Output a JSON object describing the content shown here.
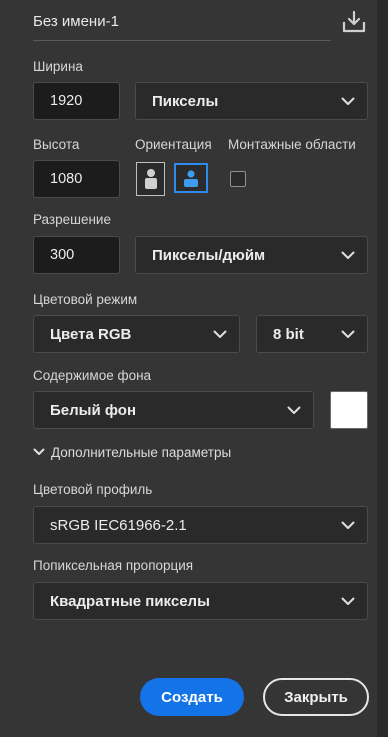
{
  "document_name": "Без имени-1",
  "width": {
    "label": "Ширина",
    "value": "1920",
    "unit": "Пикселы"
  },
  "height": {
    "label": "Высота",
    "value": "1080"
  },
  "orientation": {
    "label": "Ориентация",
    "selected": "landscape"
  },
  "artboards": {
    "label": "Монтажные области",
    "checked": false
  },
  "resolution": {
    "label": "Разрешение",
    "value": "300",
    "unit": "Пикселы/дюйм"
  },
  "color_mode": {
    "label": "Цветовой режим",
    "mode": "Цвета RGB",
    "bit_depth": "8 bit"
  },
  "background": {
    "label": "Содержимое фона",
    "value": "Белый фон",
    "swatch_color": "#ffffff"
  },
  "advanced": {
    "label": "Дополнительные параметры"
  },
  "color_profile": {
    "label": "Цветовой профиль",
    "value": "sRGB IEC61966-2.1"
  },
  "pixel_aspect": {
    "label": "Попиксельная пропорция",
    "value": "Квадратные пикселы"
  },
  "buttons": {
    "create": "Создать",
    "close": "Закрыть"
  },
  "colors": {
    "accent": "#1473e6",
    "panel": "#353535",
    "field": "#1c1c1c"
  }
}
